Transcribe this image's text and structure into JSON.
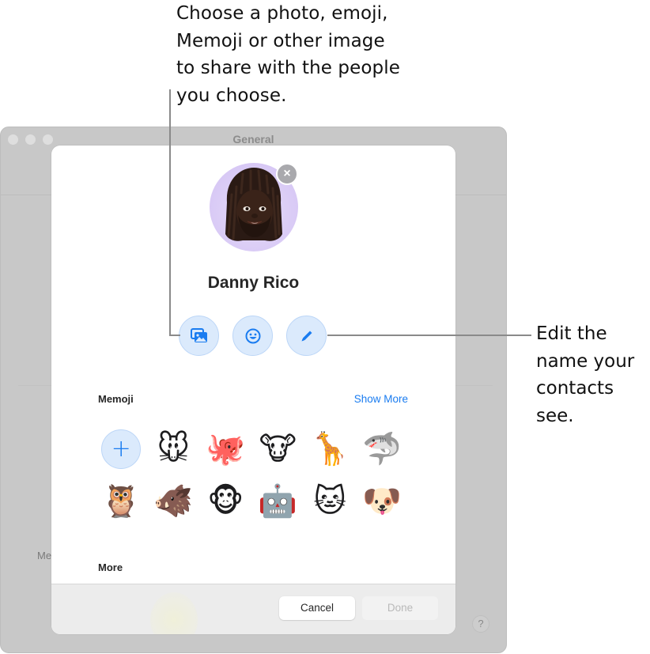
{
  "callouts": {
    "top": [
      "Choose a photo, emoji,",
      "Memoji or other image",
      "to share with the people",
      "you choose."
    ],
    "right": [
      "Edit the",
      "name your",
      "contacts",
      "see."
    ]
  },
  "window": {
    "title": "General",
    "background_label": "Me",
    "help_label": "?"
  },
  "sheet": {
    "avatar_icon": "memoji-avatar",
    "remove_label": "×",
    "name": "Danny Rico",
    "actions": [
      {
        "name": "photos",
        "icon": "photo-icon"
      },
      {
        "name": "emoji",
        "icon": "smiley-icon"
      },
      {
        "name": "edit-name",
        "icon": "pencil-icon"
      }
    ],
    "memoji_section": {
      "label": "Memoji",
      "show_more": "Show More",
      "add_label": "+",
      "rows": [
        [
          "🐭",
          "🐙",
          "🐮",
          "🦒",
          "🦈"
        ],
        [
          "🦉",
          "🐗",
          "🐵",
          "🤖",
          "🐱",
          "🐶"
        ]
      ],
      "names": [
        [
          "mouse",
          "octopus",
          "cow",
          "giraffe",
          "shark"
        ],
        [
          "owl",
          "boar",
          "monkey",
          "robot",
          "cat",
          "dog"
        ]
      ]
    },
    "more_label": "More",
    "footer": {
      "cancel": "Cancel",
      "done": "Done"
    }
  },
  "colors": {
    "accent": "#1a7cf0",
    "accent_light": "#dbeafc",
    "window_bg": "#c8c8c8",
    "avatar_bg": "#d8c9f5"
  }
}
